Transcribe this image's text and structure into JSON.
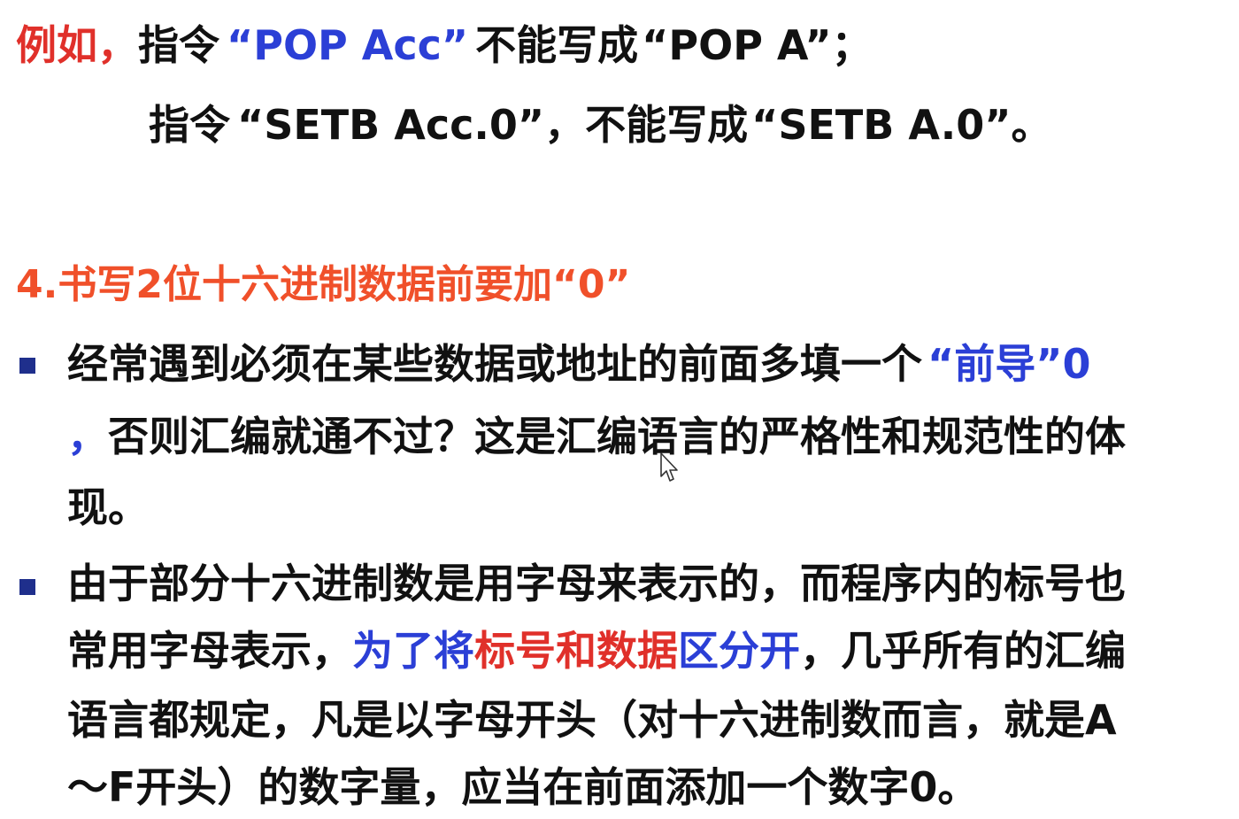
{
  "example": {
    "line1": {
      "lead": "例如，",
      "text1": "指令",
      "cmd1": "“POP  Acc”",
      "text2": "不能写成",
      "cmd2": "“POP  A”",
      "end": "；"
    },
    "line2": {
      "text1": "指令",
      "cmd1": "“SETB  Acc.0”",
      "text2": "，不能写成",
      "cmd2": "“SETB  A.0”",
      "end": "。"
    }
  },
  "section4": {
    "heading": "4.书写2位十六进制数据前要加“0”",
    "bullet1": {
      "line1_text": "经常遇到必须在某些数据或地址的前面多填一个",
      "line1_highlight": "“前导”0",
      "line2_comma": "，",
      "line2_text": "否则汇编就通不过？这是汇编语言的严格性和规范性的体",
      "line3_text": "现。"
    },
    "bullet2": {
      "line1_text": "由于部分十六进制数是用字母来表示的，而程序内的标号也",
      "line2_text1": "常用字母表示，",
      "line2_blue1": "为了将",
      "line2_red": "标号和数据",
      "line2_blue2": "区分开",
      "line2_text2": "，几乎所有的汇编",
      "line3_text": "语言都规定，凡是以字母开头（对十六进制数而言，就是A",
      "line4_text": "～F开头）的数字量，应当在前面添加一个数字0。"
    }
  },
  "colors": {
    "red": "#e0302a",
    "blue": "#2b3fd6",
    "orange": "#f0502a",
    "bullet": "#1f2f8c"
  },
  "icons": {
    "cursor": "mouse-pointer-icon",
    "bullet": "square-bullet-icon"
  }
}
